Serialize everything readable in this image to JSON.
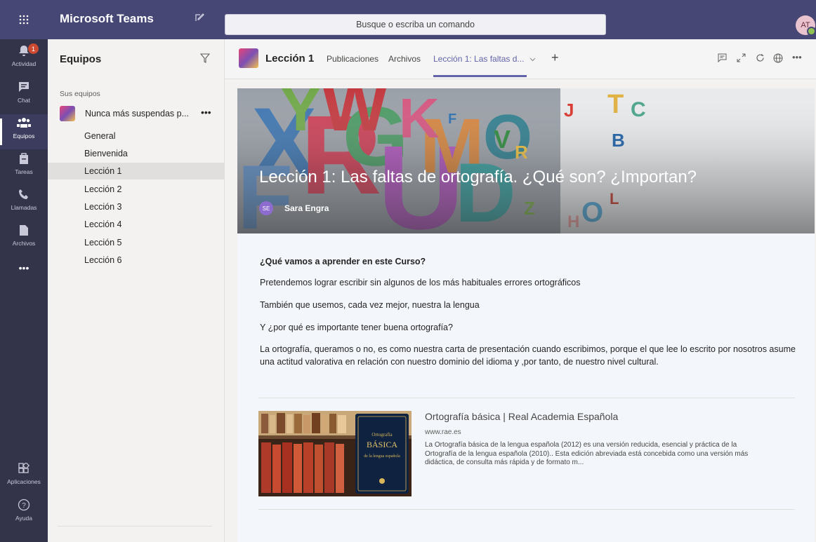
{
  "app": {
    "title": "Microsoft Teams",
    "user_initials": "AT"
  },
  "search": {
    "placeholder": "Busque o escriba un comando"
  },
  "rail": {
    "items": [
      {
        "label": "Actividad",
        "icon": "bell-icon",
        "badge": "1"
      },
      {
        "label": "Chat",
        "icon": "chat-icon"
      },
      {
        "label": "Equipos",
        "icon": "teams-icon",
        "active": true
      },
      {
        "label": "Tareas",
        "icon": "assignments-icon"
      },
      {
        "label": "Llamadas",
        "icon": "phone-icon"
      },
      {
        "label": "Archivos",
        "icon": "files-icon"
      }
    ],
    "more": "•••",
    "bottom": [
      {
        "label": "Aplicaciones",
        "icon": "apps-icon"
      },
      {
        "label": "Ayuda",
        "icon": "help-icon"
      }
    ]
  },
  "teams_panel": {
    "title": "Equipos",
    "section": "Sus equipos",
    "team_name": "Nunca más suspendas p...",
    "more": "•••",
    "channels": [
      "General",
      "Bienvenida",
      "Lección 1",
      "Lección 2",
      "Lección 3",
      "Lección 4",
      "Lección 5",
      "Lección 6"
    ],
    "selected_channel": "Lección 1"
  },
  "channel": {
    "title": "Lección 1",
    "tabs": [
      "Publicaciones",
      "Archivos",
      "Lección 1: Las faltas d..."
    ],
    "active_tab": "Lección 1: Las faltas d...",
    "add": "+"
  },
  "page": {
    "hero_title": "Lección 1: Las faltas de ortografía. ¿Qué son? ¿Importan?",
    "author_initials": "SE",
    "author": "Sara Engra",
    "heading": "¿Qué vamos a aprender en este Curso?",
    "p1": "Pretendemos lograr escribir sin algunos de los más habituales errores ortográficos",
    "p2": "También que usemos, cada vez mejor, nuestra la lengua",
    "p3": "Y ¿por qué es importante tener buena ortografía?",
    "p4": "La ortografía, queramos o no, es como nuestra carta de presentación cuando escribimos, porque el que lee lo escrito por nosotros asume una actitud valorativa en relación con nuestro dominio del idioma y ,por tanto, de nuestro nivel cultural."
  },
  "link_card": {
    "title": "Ortografía básica | Real Academia Española",
    "url": "www.rae.es",
    "description": "La Ortografía básica de la lengua española (2012) es una versión reducida, esencial y práctica de la Ortografía de la lengua española (2010).. Esta edición abreviada está concebida como una versión más didáctica, de consulta más rápida y de formato m...",
    "book_l1": "Ortografía",
    "book_l2": "BÁSICA",
    "book_l3": "de la lengua española"
  }
}
